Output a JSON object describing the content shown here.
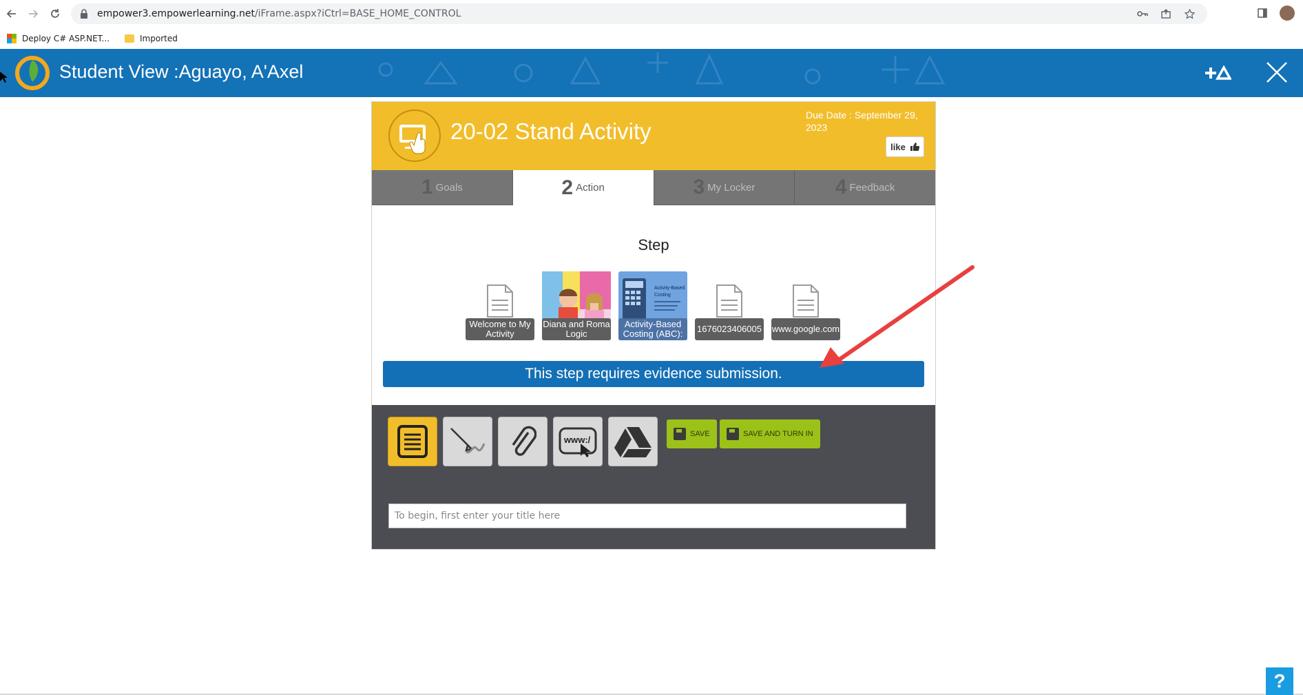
{
  "browser": {
    "url_host": "empower3.empowerlearning.net",
    "url_path": "/iFrame.aspx?iCtrl=BASE_HOME_CONTROL",
    "bookmarks": [
      {
        "label": "Deploy C# ASP.NET...",
        "icon": "microsoft-logo-icon"
      },
      {
        "label": "Imported",
        "icon": "folder-icon"
      }
    ]
  },
  "header": {
    "title": "Student View :Aguayo, A'Axel",
    "brand_color": "#1472b7"
  },
  "activity": {
    "title": "20-02 Stand Activity",
    "due_date": "Due Date : September 29, 2023",
    "like_label": "like",
    "accent_color": "#f2bd2a"
  },
  "tabs": [
    {
      "num": "1",
      "label": "Goals",
      "active": false
    },
    {
      "num": "2",
      "label": "Action",
      "active": true
    },
    {
      "num": "3",
      "label": "My Locker",
      "active": false
    },
    {
      "num": "4",
      "label": "Feedback",
      "active": false
    }
  ],
  "step": {
    "label": "Step",
    "resources": [
      {
        "caption": "Welcome to My Activity",
        "kind": "document-icon"
      },
      {
        "caption": "Diana and Roma Logic",
        "kind": "image-thumbnail"
      },
      {
        "caption": "Activity-Based Costing (ABC):",
        "kind": "image-thumbnail"
      },
      {
        "caption": "1676023406005",
        "kind": "document-icon"
      },
      {
        "caption": "www.google.com",
        "kind": "document-icon"
      }
    ],
    "thumb_text": {
      "abc_line1": "Activity-Based",
      "abc_line2": "Costing"
    },
    "requirement": "This step requires evidence submission."
  },
  "submission": {
    "tools": [
      "notes-icon",
      "pencil-draw-icon",
      "paperclip-icon",
      "www-link-icon",
      "google-drive-icon"
    ],
    "save_label": "SAVE",
    "save_turn_in_label": "SAVE AND TURN IN",
    "title_placeholder": "To begin, first enter your title here"
  },
  "help_label": "?"
}
